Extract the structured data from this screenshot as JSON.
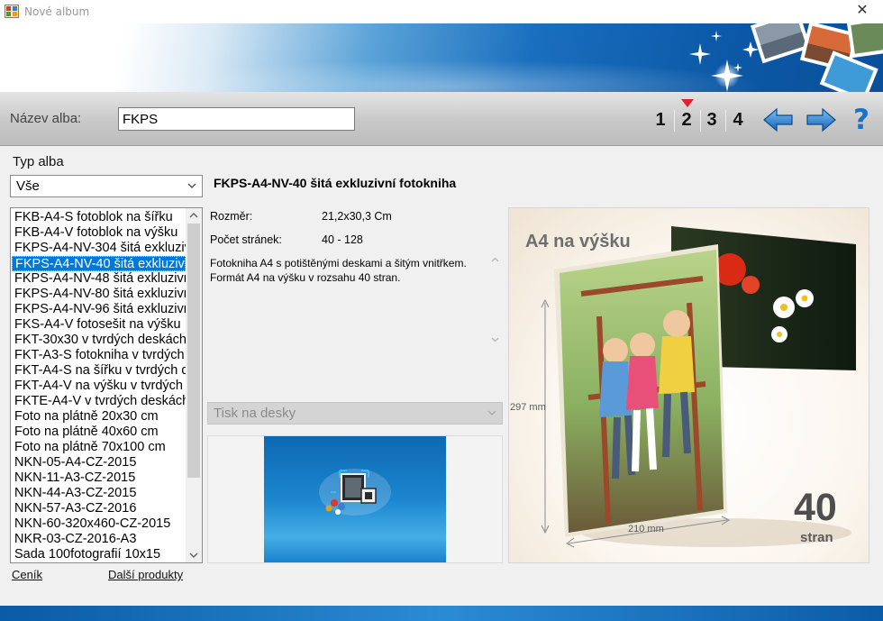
{
  "window": {
    "title": "Nové album",
    "close_glyph": "✕"
  },
  "header": {
    "name_label": "Název alba:",
    "name_value": "FKPS",
    "steps": [
      "1",
      "2",
      "3",
      "4"
    ],
    "current_step": 2,
    "help_glyph": "?"
  },
  "album_type": {
    "label": "Typ alba",
    "filter_value": "Vše",
    "items": [
      "FKB-A4-S fotoblok na šířku",
      "FKB-A4-V fotoblok na výšku",
      "FKPS-A4-NV-304 šitá exkluziv",
      "FKPS-A4-NV-40 šitá exkluzivn",
      "FKPS-A4-NV-48 šitá exkluzivn",
      "FKPS-A4-NV-80 šitá exkluzivn",
      "FKPS-A4-NV-96 šitá exkluzivn",
      "FKS-A4-V fotosešit na výšku",
      "FKT-30x30 v tvrdých deskách",
      "FKT-A3-S fotokniha v  tvrdých",
      "FKT-A4-S na šířku v tvrdých d",
      "FKT-A4-V na výšku v tvrdých",
      "FKTE-A4-V v tvrdých deskách",
      "Foto na plátně 20x30 cm",
      "Foto na plátně 40x60 cm",
      "Foto na plátně 70x100 cm",
      "NKN-05-A4-CZ-2015",
      "NKN-11-A3-CZ-2015",
      "NKN-44-A3-CZ-2015",
      "NKN-57-A3-CZ-2016",
      "NKN-60-320x460-CZ-2015",
      "NKR-03-CZ-2016-A3",
      "Sada 100fotografií 10x15"
    ],
    "selected_index": 3
  },
  "links": {
    "pricelist": "Ceník",
    "more_products": "Další produkty"
  },
  "product": {
    "title": "FKPS-A4-NV-40 šitá exkluzivní fotokniha",
    "size_label": "Rozměr:",
    "size_value": "21,2x30,3 Cm",
    "pages_label": "Počet stránek:",
    "pages_value": "40 - 128",
    "description": "Fotokniha A4 s potištěnými deskami a šitým vnitřkem. Formát A4 na výšku v rozsahu 40 stran.",
    "print_option": "Tisk na desky"
  },
  "preview": {
    "heading": "A4 na výšku",
    "height_dim": "297 mm",
    "width_dim": "210 mm",
    "pages_number": "40",
    "pages_word": "stran"
  },
  "colors": {
    "accent_blue": "#0078d7",
    "marker_red": "#e0202a",
    "banner_blue": "#0c5aa8"
  },
  "icons": [
    "app-icon",
    "close-icon",
    "arrow-left-icon",
    "arrow-right-icon",
    "help-icon",
    "chevron-down-icon"
  ]
}
